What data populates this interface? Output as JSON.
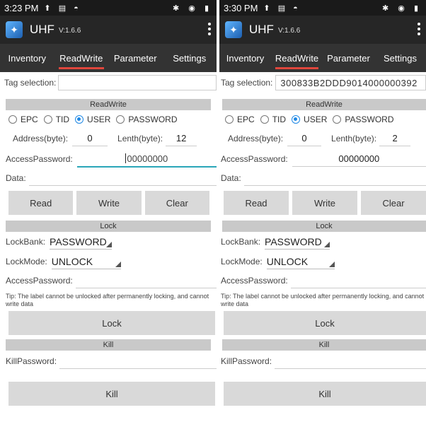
{
  "left": {
    "status": {
      "time": "3:23 PM",
      "left_icons": "⬆ ▤ ◓",
      "right_icons": "✱ ◉ ▮"
    },
    "app": {
      "title": "UHF",
      "version": "V:1.6.6"
    },
    "tabs": [
      "Inventory",
      "ReadWrite",
      "Parameter",
      "Settings"
    ],
    "tag_label": "Tag selection:",
    "tag_value": "",
    "rw_header": "ReadWrite",
    "radios": [
      "EPC",
      "TID",
      "USER",
      "PASSWORD"
    ],
    "selected_radio": "USER",
    "address_label": "Address(byte):",
    "address_value": "0",
    "length_label": "Lenth(byte):",
    "length_value": "12",
    "access_label": "AccessPassword:",
    "access_value": "00000000",
    "data_label": "Data:",
    "read_btn": "Read",
    "write_btn": "Write",
    "clear_btn": "Clear",
    "lock_header": "Lock",
    "lockbank_label": "LockBank:",
    "lockbank_value": "PASSWORD",
    "lockmode_label": "LockMode:",
    "lockmode_value": "UNLOCK",
    "lock_access_label": "AccessPassword:",
    "tip": "Tip: The label cannot be unlocked after permanently locking, and cannot write data",
    "lock_btn": "Lock",
    "kill_header": "Kill",
    "killpwd_label": "KillPassword:",
    "kill_btn": "Kill"
  },
  "right": {
    "status": {
      "time": "3:30 PM",
      "left_icons": "⬆ ▤ ◓",
      "right_icons": "✱ ◉ ▮"
    },
    "app": {
      "title": "UHF",
      "version": "V:1.6.6"
    },
    "tabs": [
      "Inventory",
      "ReadWrite",
      "Parameter",
      "Settings"
    ],
    "tag_label": "Tag selection:",
    "tag_value": "300833B2DDD9014000000392",
    "rw_header": "ReadWrite",
    "radios": [
      "EPC",
      "TID",
      "USER",
      "PASSWORD"
    ],
    "selected_radio": "USER",
    "address_label": "Address(byte):",
    "address_value": "0",
    "length_label": "Lenth(byte):",
    "length_value": "2",
    "access_label": "AccessPassword:",
    "access_value": "00000000",
    "data_label": "Data:",
    "read_btn": "Read",
    "write_btn": "Write",
    "clear_btn": "Clear",
    "lock_header": "Lock",
    "lockbank_label": "LockBank:",
    "lockbank_value": "PASSWORD",
    "lockmode_label": "LockMode:",
    "lockmode_value": "UNLOCK",
    "lock_access_label": "AccessPassword:",
    "tip": "Tip: The label cannot be unlocked after permanently locking, and cannot write data",
    "lock_btn": "Lock",
    "kill_header": "Kill",
    "killpwd_label": "KillPassword:",
    "kill_btn": "Kill"
  },
  "colors": {
    "accent": "#e0463c",
    "radio": "#1e88e5",
    "appbar": "#262626",
    "tabs": "#333333",
    "section": "#c9c9c9",
    "button": "#d9d9d9"
  }
}
